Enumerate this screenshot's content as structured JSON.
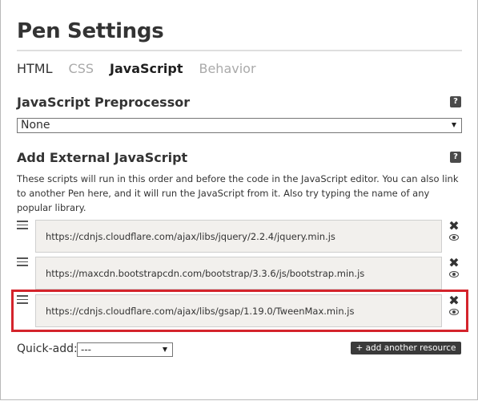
{
  "title": "Pen Settings",
  "tabs": [
    {
      "label": "HTML"
    },
    {
      "label": "CSS"
    },
    {
      "label": "JavaScript"
    },
    {
      "label": "Behavior"
    }
  ],
  "active_tab": "JavaScript",
  "preprocessor": {
    "heading": "JavaScript Preprocessor",
    "help_icon": "?",
    "selected": "None"
  },
  "external": {
    "heading": "Add External JavaScript",
    "help_icon": "?",
    "description": "These scripts will run in this order and before the code in the JavaScript editor. You can also link to another Pen here, and it will run the JavaScript from it. Also try typing the name of any popular library.",
    "resources": [
      {
        "url": "https://cdnjs.cloudflare.com/ajax/libs/jquery/2.2.4/jquery.min.js"
      },
      {
        "url": "https://maxcdn.bootstrapcdn.com/bootstrap/3.3.6/js/bootstrap.min.js"
      },
      {
        "url": "https://cdnjs.cloudflare.com/ajax/libs/gsap/1.19.0/TweenMax.min.js"
      }
    ],
    "highlighted_resource_index": 2,
    "remove_glyph": "✖"
  },
  "quick_add": {
    "label": "Quick-add:",
    "selected": "---"
  },
  "add_resource_label": "+ add another resource",
  "colors": {
    "highlight": "#d4242c",
    "input_bg": "#f2f0ed",
    "button_bg": "#3a3a3a"
  }
}
